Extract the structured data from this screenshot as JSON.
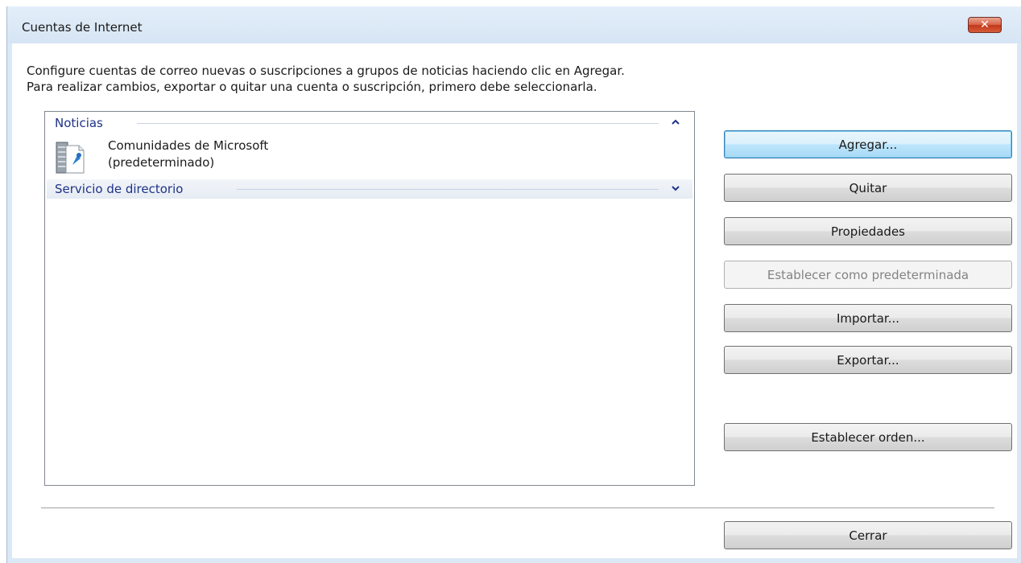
{
  "window": {
    "title": "Cuentas de Internet",
    "close_glyph": "✕"
  },
  "instructions": {
    "line1": "Configure cuentas de correo nuevas o suscripciones a grupos de noticias haciendo clic en Agregar.",
    "line2": "Para realizar cambios, exportar o quitar una cuenta o suscripción, primero debe seleccionarla."
  },
  "accounts_list": {
    "groups": [
      {
        "label": "Noticias",
        "state": "expanded",
        "chevron_icon": "chevron-up-icon",
        "items": [
          {
            "icon": "news-server-icon",
            "name": "Comunidades de Microsoft",
            "note": "(predeterminado)"
          }
        ]
      },
      {
        "label": "Servicio de directorio",
        "state": "collapsed",
        "chevron_icon": "chevron-down-icon",
        "items": []
      }
    ]
  },
  "buttons": {
    "add": "Agregar...",
    "remove": "Quitar",
    "properties": "Propiedades",
    "set_default": "Establecer como predeterminada",
    "import": "Importar...",
    "export": "Exportar...",
    "set_order": "Establecer orden...",
    "close": "Cerrar"
  },
  "colors": {
    "group_header_text": "#1e3287",
    "window_frame": "#dbe8f5",
    "close_button": "#c2381b"
  }
}
